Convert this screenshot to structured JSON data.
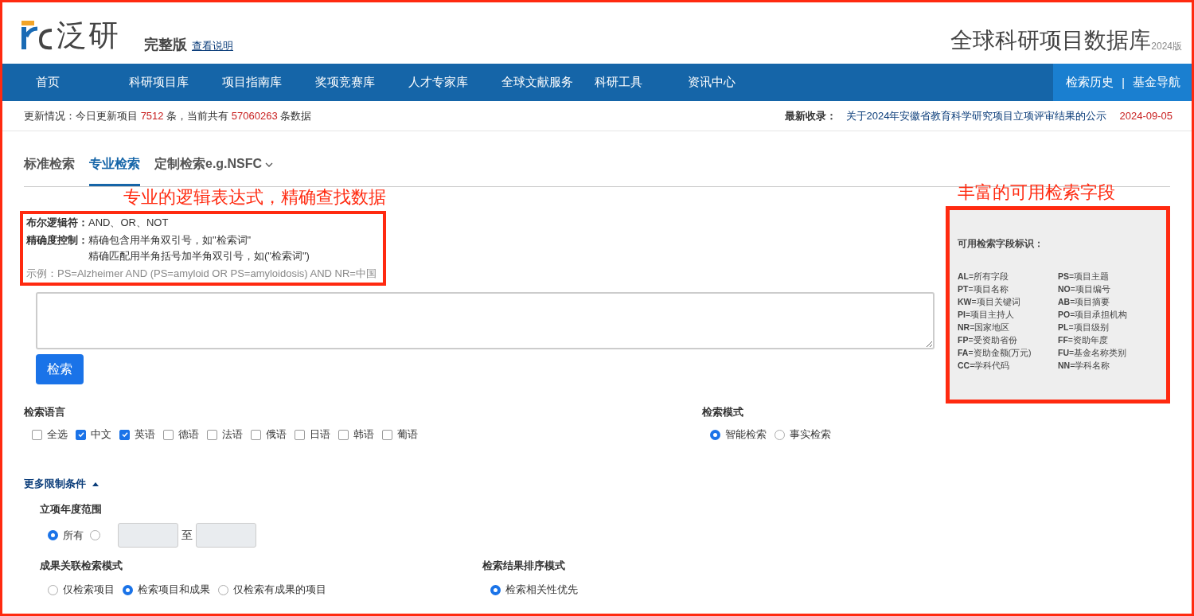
{
  "logo": {
    "text": "泛研"
  },
  "edition": {
    "label": "完整版",
    "link": "查看说明"
  },
  "site_title": {
    "text": "全球科研项目数据库",
    "version": "2024版"
  },
  "nav": {
    "items": [
      {
        "label": "首页"
      },
      {
        "label": "科研项目库"
      },
      {
        "label": "项目指南库"
      },
      {
        "label": "奖项竞赛库"
      },
      {
        "label": "人才专家库"
      },
      {
        "label": "全球文献服务"
      },
      {
        "label": "科研工具"
      },
      {
        "label": "资讯中心"
      }
    ],
    "right_links": [
      "检索历史",
      "基金导航"
    ],
    "separator": "|"
  },
  "update_bar": {
    "segments": [
      {
        "text": "更新情况：今日更新项目 ",
        "highlight": false
      },
      {
        "text": "7512",
        "highlight": true
      },
      {
        "text": " 条，当前共有 ",
        "highlight": false
      },
      {
        "text": "57060263",
        "highlight": true
      },
      {
        "text": " 条数据",
        "highlight": false
      }
    ],
    "latest_label": "最新收录：",
    "latest_title": "关于2024年安徽省教育科学研究项目立项评审结果的公示",
    "latest_date": "2024-09-05"
  },
  "tabs": [
    {
      "label": "标准检索",
      "selected": false,
      "dropdown": false
    },
    {
      "label": "专业检索",
      "selected": true,
      "dropdown": false
    },
    {
      "label": "定制检索e.g.NSFC",
      "selected": false,
      "dropdown": true
    }
  ],
  "annotation_left": "专业的逻辑表达式，精确查找数据",
  "annotation_right": "丰富的可用检索字段",
  "syntax_help": {
    "rows": [
      {
        "label": "布尔逻辑符：",
        "lines": [
          "AND、OR、NOT"
        ]
      },
      {
        "label": "精确度控制：",
        "lines": [
          "精确包含用半角双引号，如\"检索词\"",
          "精确匹配用半角括号加半角双引号，如(\"检索词\")"
        ]
      }
    ],
    "example": "示例：PS=Alzheimer AND (PS=amyloid OR PS=amyloidosis) AND NR=中国"
  },
  "search_button": "检索",
  "field_panel": {
    "title": "可用检索字段标识：",
    "fields": [
      {
        "code": "AL",
        "name": "=所有字段"
      },
      {
        "code": "PS",
        "name": "=项目主题"
      },
      {
        "code": "PT",
        "name": "=项目名称"
      },
      {
        "code": "NO",
        "name": "=项目编号"
      },
      {
        "code": "KW",
        "name": "=项目关键词"
      },
      {
        "code": "AB",
        "name": "=项目摘要"
      },
      {
        "code": "PI",
        "name": "=项目主持人"
      },
      {
        "code": "PO",
        "name": "=项目承担机构"
      },
      {
        "code": "NR",
        "name": "=国家地区"
      },
      {
        "code": "PL",
        "name": "=项目级别"
      },
      {
        "code": "FP",
        "name": "=受资助省份"
      },
      {
        "code": "FF",
        "name": "=资助年度"
      },
      {
        "code": "FA",
        "name": "=资助金额(万元)"
      },
      {
        "code": "FU",
        "name": "=基金名称类别"
      },
      {
        "code": "CC",
        "name": "=学科代码"
      },
      {
        "code": "NN",
        "name": "=学科名称"
      }
    ]
  },
  "language": {
    "title": "检索语言",
    "options": [
      {
        "label": "全选",
        "checked": false
      },
      {
        "label": "中文",
        "checked": true
      },
      {
        "label": "英语",
        "checked": true
      },
      {
        "label": "德语",
        "checked": false
      },
      {
        "label": "法语",
        "checked": false
      },
      {
        "label": "俄语",
        "checked": false
      },
      {
        "label": "日语",
        "checked": false
      },
      {
        "label": "韩语",
        "checked": false
      },
      {
        "label": "葡语",
        "checked": false
      }
    ]
  },
  "mode": {
    "title": "检索模式",
    "options": [
      {
        "label": "智能检索",
        "selected": true
      },
      {
        "label": "事实检索",
        "selected": false
      }
    ]
  },
  "more_conditions": {
    "title": "更多限制条件",
    "expanded": true
  },
  "year_range": {
    "title": "立项年度范围",
    "options": [
      {
        "label": "所有",
        "selected": true
      },
      {
        "selected": false
      }
    ],
    "to_label": "至"
  },
  "result_link_mode": {
    "title": "成果关联检索模式",
    "options": [
      {
        "label": "仅检索项目",
        "selected": false
      },
      {
        "label": "检索项目和成果",
        "selected": true
      },
      {
        "label": "仅检索有成果的项目",
        "selected": false
      }
    ]
  },
  "sort_mode": {
    "title": "检索结果排序模式",
    "options": [
      {
        "label": "检索相关性优先",
        "selected": true
      }
    ]
  }
}
